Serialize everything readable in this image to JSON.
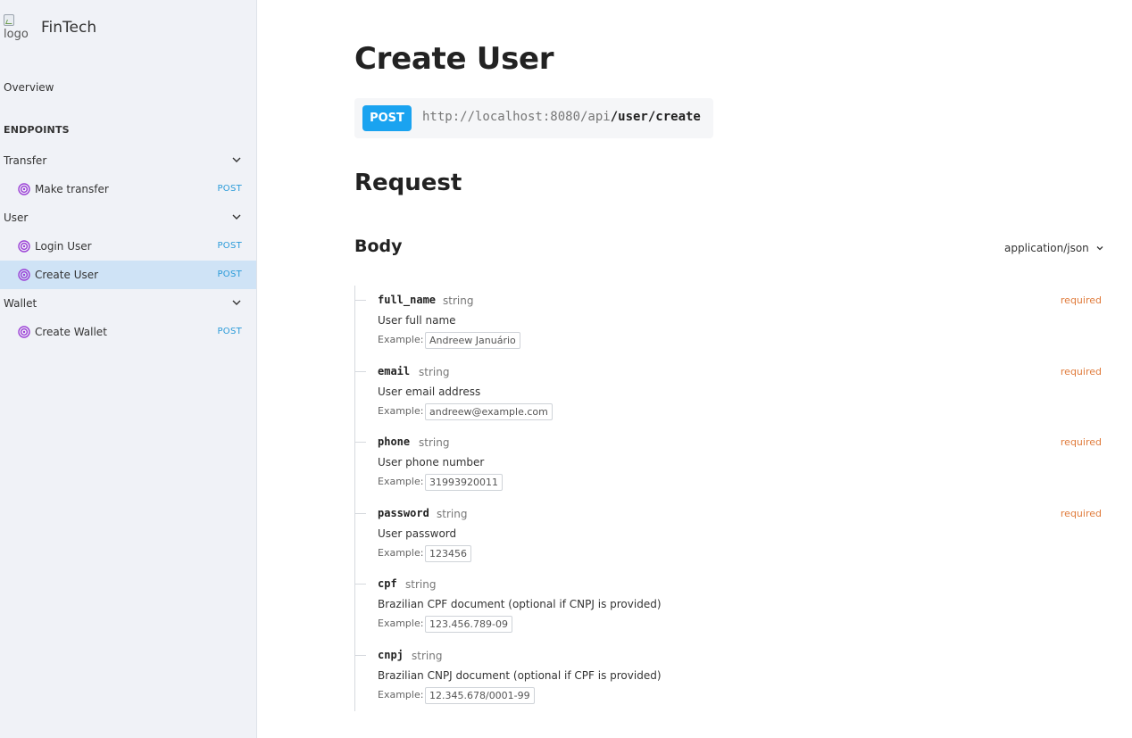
{
  "sidebar": {
    "brand": {
      "logo_alt": "logo",
      "name": "FinTech"
    },
    "overview": "Overview",
    "section_label": "ENDPOINTS",
    "groups": [
      {
        "label": "Transfer",
        "items": [
          {
            "label": "Make transfer",
            "method": "POST"
          }
        ]
      },
      {
        "label": "User",
        "items": [
          {
            "label": "Login User",
            "method": "POST"
          },
          {
            "label": "Create User",
            "method": "POST",
            "active": true
          }
        ]
      },
      {
        "label": "Wallet",
        "items": [
          {
            "label": "Create Wallet",
            "method": "POST"
          }
        ]
      }
    ],
    "icons": {
      "group_toggle": "chevron-down-icon",
      "endpoint": "target-icon"
    }
  },
  "main": {
    "title": "Create User",
    "endpoint": {
      "method": "POST",
      "base_url": "http://localhost:8080/api",
      "path": "/user/create"
    },
    "request_heading": "Request",
    "body_heading": "Body",
    "content_type": "application/json",
    "example_label": "Example:",
    "properties": [
      {
        "name": "full_name",
        "type": "string",
        "required": "required",
        "description": "User full name",
        "example": "Andreew Januário"
      },
      {
        "name": "email",
        "type": "string",
        "required": "required",
        "description": "User email address",
        "example": "andreew@example.com"
      },
      {
        "name": "phone",
        "type": "string",
        "required": "required",
        "description": "User phone number",
        "example": "31993920011"
      },
      {
        "name": "password",
        "type": "string",
        "required": "required",
        "description": "User password",
        "example": "123456"
      },
      {
        "name": "cpf",
        "type": "string",
        "required": "",
        "description": "Brazilian CPF document (optional if CNPJ is provided)",
        "example": "123.456.789-09"
      },
      {
        "name": "cnpj",
        "type": "string",
        "required": "",
        "description": "Brazilian CNPJ document (optional if CPF is provided)",
        "example": "12.345.678/0001-99"
      }
    ]
  },
  "colors": {
    "sidebar_bg": "#f0f2f7",
    "active_bg": "#cfe3f6",
    "method_badge": "#1aa3f0",
    "method_text": "#2b9bd9",
    "required": "#e07b3b",
    "target_icon": "#9b3fd6"
  }
}
